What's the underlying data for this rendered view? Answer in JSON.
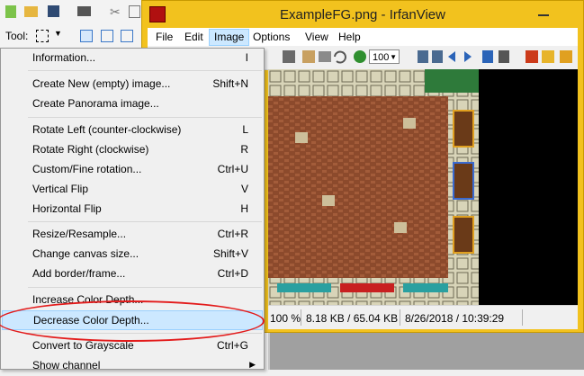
{
  "background": {
    "tool_label": "Tool:"
  },
  "window": {
    "title": "ExampleFG.png - IrfanView",
    "menu": [
      "File",
      "Edit",
      "Image",
      "Options",
      "View",
      "Help"
    ],
    "active_menu": "Image",
    "zoom": "100",
    "status": {
      "zoom": "100 %",
      "size": "8.18 KB / 65.04 KB",
      "date": "8/26/2018 / 10:39:29"
    },
    "colors": {
      "window_frame": "#f2c21e",
      "highlight": "#cce8ff",
      "annotation": "#e31b1b"
    }
  },
  "dropdown": {
    "items": [
      {
        "label": "Information...",
        "shortcut": "I"
      },
      {
        "label": "Create New (empty) image...",
        "shortcut": "Shift+N"
      },
      {
        "label": "Create Panorama image...",
        "shortcut": ""
      },
      {
        "label": "Rotate Left (counter-clockwise)",
        "shortcut": "L"
      },
      {
        "label": "Rotate Right (clockwise)",
        "shortcut": "R"
      },
      {
        "label": "Custom/Fine rotation...",
        "shortcut": "Ctrl+U"
      },
      {
        "label": "Vertical Flip",
        "shortcut": "V"
      },
      {
        "label": "Horizontal Flip",
        "shortcut": "H"
      },
      {
        "label": "Resize/Resample...",
        "shortcut": "Ctrl+R"
      },
      {
        "label": "Change canvas size...",
        "shortcut": "Shift+V"
      },
      {
        "label": "Add border/frame...",
        "shortcut": "Ctrl+D"
      },
      {
        "label": "Increase Color Depth...",
        "shortcut": ""
      },
      {
        "label": "Decrease Color Depth...",
        "shortcut": ""
      },
      {
        "label": "Convert to Grayscale",
        "shortcut": "Ctrl+G"
      },
      {
        "label": "Show channel",
        "shortcut": ""
      }
    ]
  }
}
